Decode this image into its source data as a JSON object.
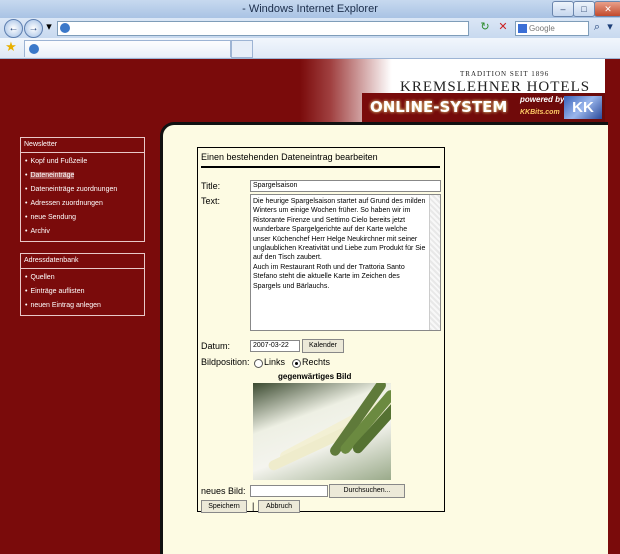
{
  "browser": {
    "title": "- Windows Internet Explorer",
    "search_placeholder": "Google Österreich",
    "back_glyph": "←",
    "forward_glyph": "→",
    "dropdown_glyph": "▾",
    "refresh_glyph": "↻",
    "stop_glyph": "✕",
    "search_glyph": "⌕",
    "star_glyph": "★",
    "minimize_glyph": "–",
    "maximize_glyph": "□",
    "close_glyph": "✕"
  },
  "header": {
    "tradition": "TRADITION SEIT 1896",
    "brand": "KREMSLEHNER HOTELS WIEN",
    "online": "ONLINE-SYSTEM",
    "powered": "powered by",
    "kkbits": "KKBits.com",
    "logo": "KK"
  },
  "sidebar": {
    "newsletter": {
      "title": "Newsletter",
      "items": [
        "Kopf und Fußzeile",
        "Dateneinträge",
        "Dateneinträge zuordnungen",
        "Adressen zuordnungen",
        "neue Sendung",
        "Archiv"
      ]
    },
    "adressdatenbank": {
      "title": "Adressdatenbank",
      "items": [
        "Quellen",
        "Einträge auflisten",
        "neuen Eintrag anlegen"
      ]
    }
  },
  "form": {
    "heading": "Einen bestehenden Dateneintrag bearbeiten",
    "title_label": "Title:",
    "title_value": "Spargelsaison",
    "text_label": "Text:",
    "text_value": "Die heurige Spargelsaison startet auf Grund des milden Winters um einige Wochen früher. So haben wir im Ristorante Firenze und Settimo Cielo bereits jetzt wunderbare Spargelgerichte auf der Karte welche unser Küchenchef Herr Helge Neukirchner mit seiner unglaublichen Kreativität und Liebe zum Produkt für Sie auf den Tisch zaubert.\nAuch im Restaurant Roth und der Trattoria Santo Stefano steht die aktuelle Karte im Zeichen des Spargels und Bärlauchs.",
    "datum_label": "Datum:",
    "datum_value": "2007-03-22",
    "kalender_button": "Kalender",
    "bildposition_label": "Bildposition:",
    "links_label": "Links",
    "rechts_label": "Rechts",
    "bild_caption": "gegenwärtiges Bild",
    "neues_bild_label": "neues Bild:",
    "durchsuchen_button": "Durchsuchen...",
    "speichern_button": "Speichern",
    "separator": "|",
    "abbruch_button": "Abbruch"
  }
}
